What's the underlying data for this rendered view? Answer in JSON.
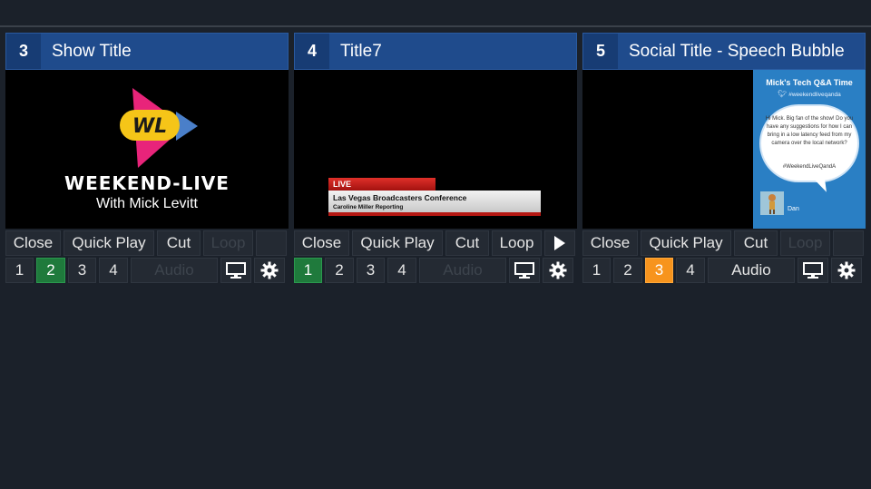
{
  "panels": [
    {
      "number": "3",
      "title": "Show Title",
      "preview": {
        "logo_text": "WL",
        "name": "WEEKEND-LIVE",
        "subtitle": "With Mick Levitt"
      },
      "controls": {
        "close": "Close",
        "quick_play": "Quick Play",
        "cut": "Cut",
        "loop": "Loop",
        "loop_enabled": false,
        "play_visible": false
      },
      "layers": [
        "1",
        "2",
        "3",
        "4"
      ],
      "active_layer": "2",
      "active_color": "#1f7a3c",
      "audio": "Audio",
      "audio_enabled": false
    },
    {
      "number": "4",
      "title": "Title7",
      "preview": {
        "tag": "LIVE",
        "headline": "Las Vegas Broadcasters Conference",
        "byline": "Caroline Miller Reporting"
      },
      "controls": {
        "close": "Close",
        "quick_play": "Quick Play",
        "cut": "Cut",
        "loop": "Loop",
        "loop_enabled": true,
        "play_visible": true
      },
      "layers": [
        "1",
        "2",
        "3",
        "4"
      ],
      "active_layer": "1",
      "active_color": "#1f7a3c",
      "audio": "Audio",
      "audio_enabled": false
    },
    {
      "number": "5",
      "title": "Social Title - Speech Bubble",
      "preview": {
        "title": "Mick's Tech Q&A Time",
        "handle": "#weekendliveqanda",
        "message": "Hi Mick. Big fan of the show! Do you have any suggestions for how I can bring in a low latency feed from my camera over the local network?",
        "hashtag": "#WeekendLiveQandA",
        "author": "Dan"
      },
      "controls": {
        "close": "Close",
        "quick_play": "Quick Play",
        "cut": "Cut",
        "loop": "Loop",
        "loop_enabled": false,
        "play_visible": false
      },
      "layers": [
        "1",
        "2",
        "3",
        "4"
      ],
      "active_layer": "3",
      "active_color": "#f7941d",
      "audio": "Audio",
      "audio_enabled": true
    }
  ],
  "icons": {
    "output": "monitor-icon",
    "settings": "gear-icon",
    "play": "play-icon",
    "social": "twitter-icon"
  }
}
